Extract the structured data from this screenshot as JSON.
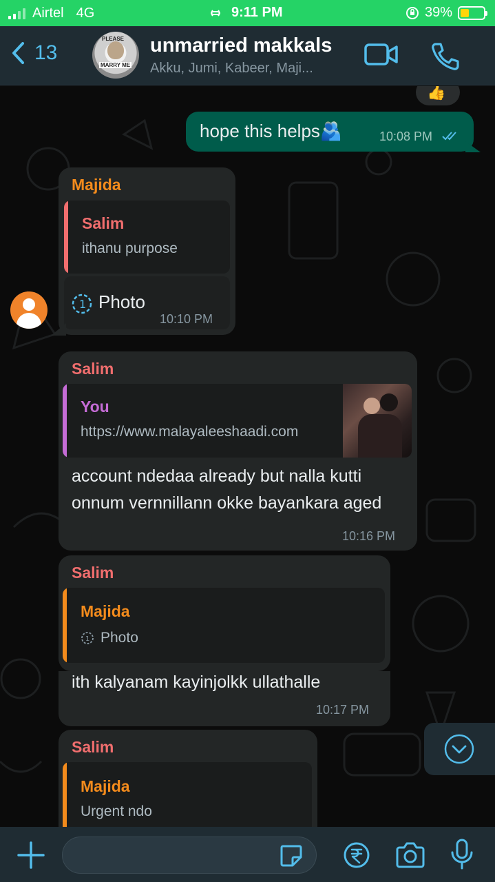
{
  "status_bar": {
    "carrier": "Airtel",
    "network": "4G",
    "time": "9:11 PM",
    "battery": "39%",
    "battery_level": 0.39
  },
  "header": {
    "back_count": "13",
    "title": "unmarried makkals",
    "subtitle": "Akku, Jumi, Kabeer, Maji...",
    "avatar_text_top": "PLEASE",
    "avatar_text_bottom": "MARRY ME"
  },
  "messages": [
    {
      "reaction": "👍"
    },
    {
      "text": "hope this helps🫂",
      "time": "10:08 PM",
      "status": "read"
    },
    {
      "sender": "Majida",
      "quote_name": "Salim",
      "quote_text": "ithanu purpose",
      "text": "Photo",
      "time": "10:10 PM"
    },
    {
      "sender": "Salim",
      "quote_name": "You",
      "quote_text": "https://www.malayaleeshaadi.com",
      "text": "account ndedaa already but nalla kutti onnum vernnillann okke bayankara aged",
      "time": "10:16 PM"
    },
    {
      "sender": "Salim",
      "quote_name": "Majida",
      "quote_text": "Photo",
      "text": "ith kalyanam kayinjolkk ullathalle",
      "time": "10:17 PM"
    },
    {
      "sender": "Salim",
      "quote_name": "Majida",
      "quote_text": "Urgent ndo"
    }
  ],
  "colors": {
    "accent": "#53bdeb",
    "status_bar": "#25d366",
    "outgoing_bubble": "#005c4b",
    "incoming_bubble": "#232626",
    "majida": "#f38b1c",
    "salim": "#f16e6e",
    "you": "#c56cd6"
  }
}
